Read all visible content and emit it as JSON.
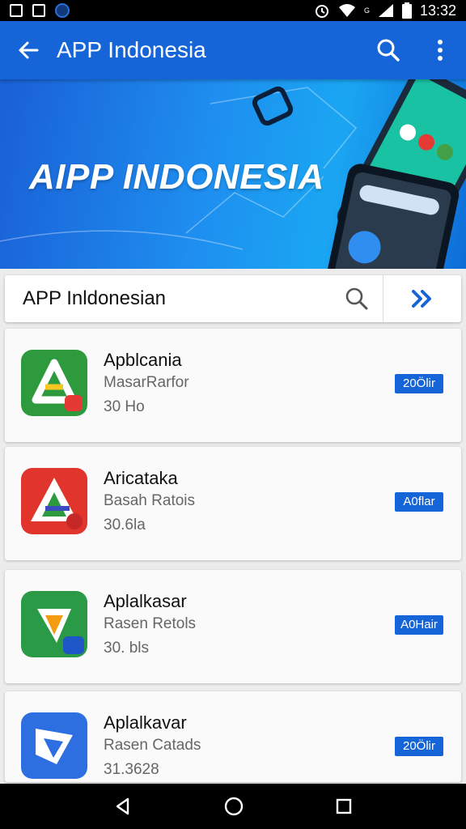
{
  "status_bar": {
    "time": "13:32",
    "network_label": "G"
  },
  "app_bar": {
    "title": "APP Indonesia",
    "icons": [
      "arrow-back-icon",
      "search-icon",
      "more-vert-icon"
    ]
  },
  "banner": {
    "text": "AIPP INDONESIA"
  },
  "search": {
    "value": "APP Inldonesian"
  },
  "apps": [
    {
      "name": "Apblcania",
      "subtitle": "MasarRarfor",
      "meta": "30 Ho",
      "badge": "20Ölir",
      "icon_color": "#2e9a3e"
    },
    {
      "name": "Aricataka",
      "subtitle": "Basah Ratois",
      "meta": "30.6la",
      "badge": "A0flar",
      "icon_color": "#e0342c"
    },
    {
      "name": "Aplalkasar",
      "subtitle": "Rasen Retols",
      "meta": "30. bls",
      "badge": "A0Hair",
      "icon_color": "#2b9a47"
    },
    {
      "name": "Aplalkavar",
      "subtitle": "Rasen Catads",
      "meta": "31.3628",
      "badge": "20Ölir",
      "icon_color": "#2d6fe0"
    }
  ],
  "nav_bar": {
    "icons": [
      "back-triangle-icon",
      "home-circle-icon",
      "recents-square-icon"
    ]
  }
}
